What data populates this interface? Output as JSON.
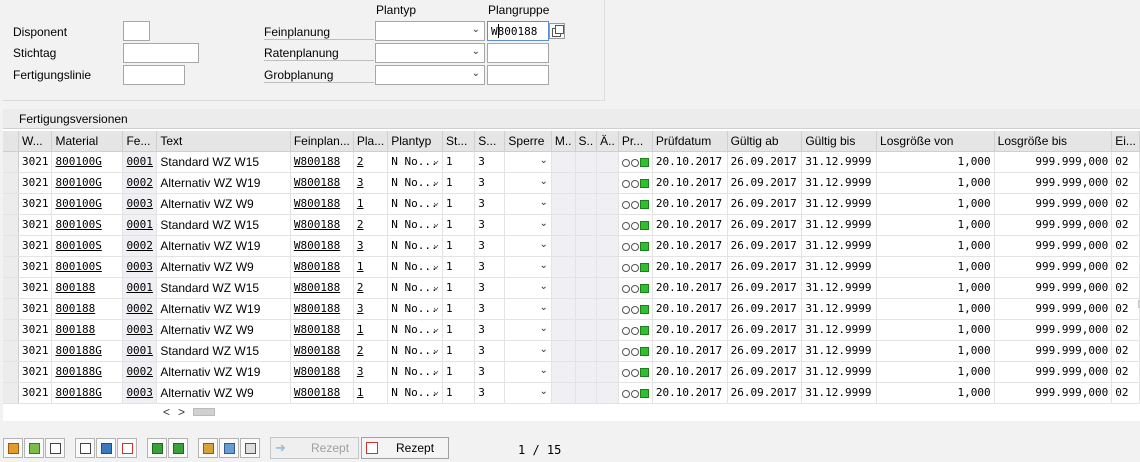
{
  "header": {
    "col_plantyp": "Plantyp",
    "col_plangruppe": "Plangruppe",
    "disponent_label": "Disponent",
    "stichtag_label": "Stichtag",
    "fertigungslinie_label": "Fertigungslinie",
    "feinplanung_label": "Feinplanung",
    "ratenplanung_label": "Ratenplanung",
    "grobplanung_label": "Grobplanung",
    "disponent_value": "",
    "stichtag_value": "",
    "fertigungslinie_value": "",
    "feinplanung_plantyp": "",
    "ratenplanung_plantyp": "",
    "grobplanung_plantyp": "",
    "feinplanung_plangruppe": "W800188",
    "ratenplanung_plangruppe": "",
    "grobplanung_plangruppe": ""
  },
  "table": {
    "title": "Fertigungsversionen",
    "columns": [
      "W...",
      "Material",
      "Fe...",
      "Text",
      "Feinplan...",
      "Pla...",
      "Plantyp",
      "St...",
      "S...",
      "Sperre",
      "M..",
      "S..",
      "Ä..",
      "Pr...",
      "Prüfdatum",
      "Gültig ab",
      "Gültig bis",
      "Losgröße von",
      "Losgröße bis",
      "Ei..."
    ],
    "rows": [
      {
        "werk": "3021",
        "material": "800100G",
        "fv": "0001",
        "text": "Standard WZ W15",
        "feinplan": "W800188",
        "pla": "2",
        "plantyp": "N No...",
        "st": "1",
        "s": "3",
        "pruefdatum": "20.10.2017",
        "gueltig_ab": "26.09.2017",
        "gueltig_bis": "31.12.9999",
        "los_von": "1,000",
        "los_bis": "999.999,000",
        "ei": "02"
      },
      {
        "werk": "3021",
        "material": "800100G",
        "fv": "0002",
        "text": "Alternativ WZ W19",
        "feinplan": "W800188",
        "pla": "3",
        "plantyp": "N No...",
        "st": "1",
        "s": "3",
        "pruefdatum": "20.10.2017",
        "gueltig_ab": "26.09.2017",
        "gueltig_bis": "31.12.9999",
        "los_von": "1,000",
        "los_bis": "999.999,000",
        "ei": "02"
      },
      {
        "werk": "3021",
        "material": "800100G",
        "fv": "0003",
        "text": "Alternativ WZ W9",
        "feinplan": "W800188",
        "pla": "1",
        "plantyp": "N No...",
        "st": "1",
        "s": "3",
        "pruefdatum": "20.10.2017",
        "gueltig_ab": "26.09.2017",
        "gueltig_bis": "31.12.9999",
        "los_von": "1,000",
        "los_bis": "999.999,000",
        "ei": "02"
      },
      {
        "werk": "3021",
        "material": "800100S",
        "fv": "0001",
        "text": "Standard WZ W15",
        "feinplan": "W800188",
        "pla": "2",
        "plantyp": "N No...",
        "st": "1",
        "s": "3",
        "pruefdatum": "20.10.2017",
        "gueltig_ab": "26.09.2017",
        "gueltig_bis": "31.12.9999",
        "los_von": "1,000",
        "los_bis": "999.999,000",
        "ei": "02"
      },
      {
        "werk": "3021",
        "material": "800100S",
        "fv": "0002",
        "text": "Alternativ WZ W19",
        "feinplan": "W800188",
        "pla": "3",
        "plantyp": "N No...",
        "st": "1",
        "s": "3",
        "pruefdatum": "20.10.2017",
        "gueltig_ab": "26.09.2017",
        "gueltig_bis": "31.12.9999",
        "los_von": "1,000",
        "los_bis": "999.999,000",
        "ei": "02"
      },
      {
        "werk": "3021",
        "material": "800100S",
        "fv": "0003",
        "text": "Alternativ WZ W9",
        "feinplan": "W800188",
        "pla": "1",
        "plantyp": "N No...",
        "st": "1",
        "s": "3",
        "pruefdatum": "20.10.2017",
        "gueltig_ab": "26.09.2017",
        "gueltig_bis": "31.12.9999",
        "los_von": "1,000",
        "los_bis": "999.999,000",
        "ei": "02"
      },
      {
        "werk": "3021",
        "material": "800188",
        "fv": "0001",
        "text": "Standard WZ W15",
        "feinplan": "W800188",
        "pla": "2",
        "plantyp": "N No...",
        "st": "1",
        "s": "3",
        "pruefdatum": "20.10.2017",
        "gueltig_ab": "26.09.2017",
        "gueltig_bis": "31.12.9999",
        "los_von": "1,000",
        "los_bis": "999.999,000",
        "ei": "02"
      },
      {
        "werk": "3021",
        "material": "800188",
        "fv": "0002",
        "text": "Alternativ WZ W19",
        "feinplan": "W800188",
        "pla": "3",
        "plantyp": "N No...",
        "st": "1",
        "s": "3",
        "pruefdatum": "20.10.2017",
        "gueltig_ab": "26.09.2017",
        "gueltig_bis": "31.12.9999",
        "los_von": "1,000",
        "los_bis": "999.999,000",
        "ei": "02"
      },
      {
        "werk": "3021",
        "material": "800188",
        "fv": "0003",
        "text": "Alternativ WZ W9",
        "feinplan": "W800188",
        "pla": "1",
        "plantyp": "N No...",
        "st": "1",
        "s": "3",
        "pruefdatum": "20.10.2017",
        "gueltig_ab": "26.09.2017",
        "gueltig_bis": "31.12.9999",
        "los_von": "1,000",
        "los_bis": "999.999,000",
        "ei": "02"
      },
      {
        "werk": "3021",
        "material": "800188G",
        "fv": "0001",
        "text": "Standard WZ W15",
        "feinplan": "W800188",
        "pla": "2",
        "plantyp": "N No...",
        "st": "1",
        "s": "3",
        "pruefdatum": "20.10.2017",
        "gueltig_ab": "26.09.2017",
        "gueltig_bis": "31.12.9999",
        "los_von": "1,000",
        "los_bis": "999.999,000",
        "ei": "02"
      },
      {
        "werk": "3021",
        "material": "800188G",
        "fv": "0002",
        "text": "Alternativ WZ W19",
        "feinplan": "W800188",
        "pla": "3",
        "plantyp": "N No...",
        "st": "1",
        "s": "3",
        "pruefdatum": "20.10.2017",
        "gueltig_ab": "26.09.2017",
        "gueltig_bis": "31.12.9999",
        "los_von": "1,000",
        "los_bis": "999.999,000",
        "ei": "02"
      },
      {
        "werk": "3021",
        "material": "800188G",
        "fv": "0003",
        "text": "Alternativ WZ W9",
        "feinplan": "W800188",
        "pla": "1",
        "plantyp": "N No...",
        "st": "1",
        "s": "3",
        "pruefdatum": "20.10.2017",
        "gueltig_ab": "26.09.2017",
        "gueltig_bis": "31.12.9999",
        "los_von": "1,000",
        "los_bis": "999.999,000",
        "ei": "02"
      }
    ]
  },
  "toolbar": {
    "icons": [
      "copy-doc-icon",
      "export-icon",
      "select-icon",
      "new-doc-icon",
      "delete-icon",
      "delete-row-icon",
      "align-top-icon",
      "align-bottom-icon",
      "tools-icon",
      "edit-icon",
      "copy-table-icon"
    ],
    "rezept_disabled_label": "Rezept",
    "rezept_label": "Rezept"
  },
  "pager": {
    "text": "1 / 15"
  },
  "scroll": {
    "left": "<",
    "right": ">"
  }
}
